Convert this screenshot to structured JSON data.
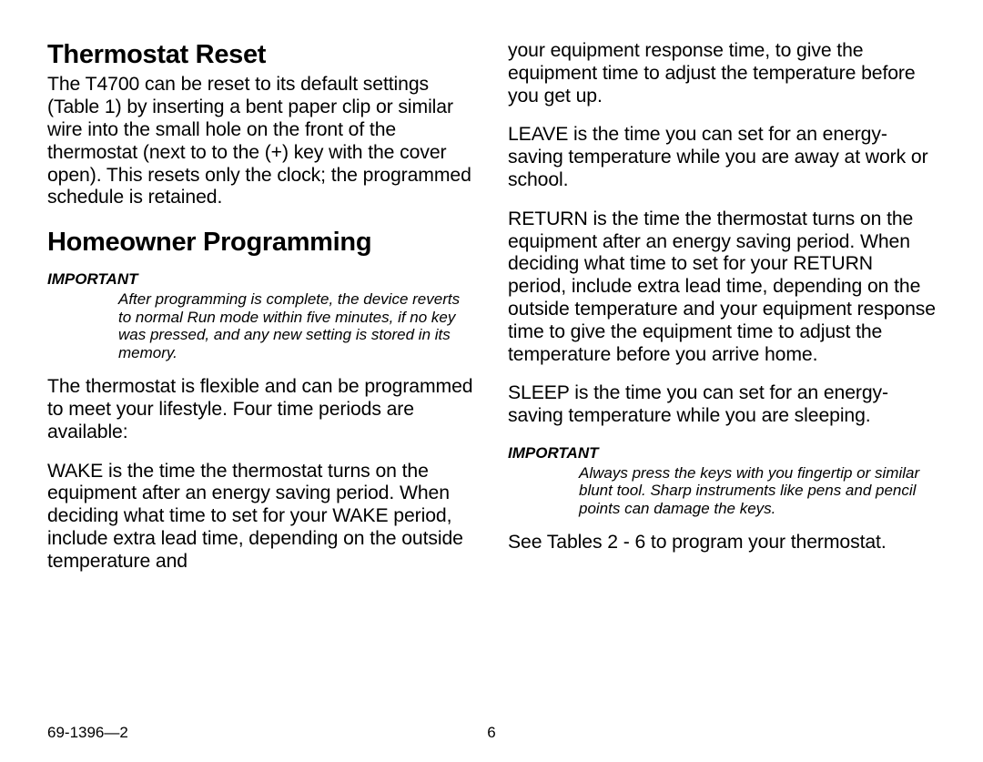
{
  "left": {
    "h_reset": "Thermostat Reset",
    "p_reset": "The T4700 can be reset to its default settings (Table 1) by inserting a bent paper clip or similar wire into the small hole on the front of the thermostat (next to to the (+) key with the cover open). This resets only the clock; the programmed schedule is retained.",
    "h_prog": "Homeowner Programming",
    "imp1_label": "IMPORTANT",
    "imp1_body": "After programming is complete, the device reverts to normal Run mode within five minutes, if no key was pressed, and any new setting is stored in its memory.",
    "p_flex": "The thermostat is flexible and can be programmed to meet your lifestyle. Four time periods are available:",
    "p_wake": "WAKE is the time the thermostat turns on the equipment after an energy saving period. When deciding what time to set for your WAKE period, include extra lead time, depending on the outside temperature and"
  },
  "right": {
    "p_cont": "your equipment response time, to give the equipment time to adjust the temperature before you get up.",
    "p_leave": "LEAVE is the time you can set for an energy-saving temperature while you are away at work or school.",
    "p_return": "RETURN is the time the thermostat turns on the equipment after an energy saving period. When deciding what time to set for your RETURN period, include extra lead time, depending on the outside temperature and your equipment response time to give the equipment time to adjust the temperature before you arrive home.",
    "p_sleep": "SLEEP is the time you can set for an energy-saving temperature while you are sleeping.",
    "imp2_label": "IMPORTANT",
    "imp2_body": "Always press the keys with you fingertip or similar blunt tool. Sharp instruments like pens and pencil points can damage the keys.",
    "p_see": "See Tables 2 - 6 to program your thermostat."
  },
  "footer": {
    "docnum": "69-1396—2",
    "pagenum": "6"
  }
}
